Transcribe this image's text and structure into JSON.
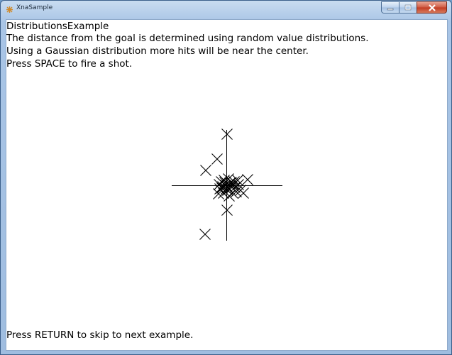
{
  "window": {
    "title": "XnaSample",
    "icon": "xna-app-icon",
    "controls": [
      "minimize-icon",
      "maximize-icon",
      "close-icon"
    ]
  },
  "content": {
    "title_line": "DistributionsExample",
    "description_line_1": "The distance from the goal is determined using random value distributions.",
    "description_line_2": "Using a Gaussian distribution more hits will be near the center.",
    "instruction": "Press SPACE to fire a shot.",
    "footer": "Press RETURN to skip to next example."
  },
  "target": {
    "icon": "crosshair-target",
    "marker": "x-mark",
    "shots_shown": 34
  },
  "colors": {
    "background": "#ffffff",
    "text": "#000000",
    "marks": "#000000",
    "close_button": "#c23a22"
  }
}
